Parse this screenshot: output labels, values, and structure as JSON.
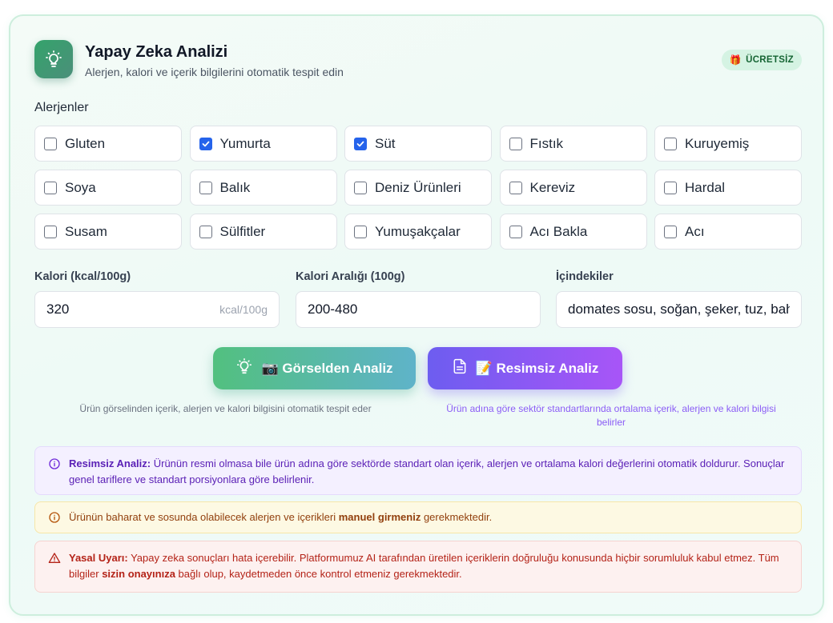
{
  "header": {
    "title": "Yapay Zeka Analizi",
    "subtitle": "Alerjen, kalori ve içerik bilgilerini otomatik tespit edin",
    "badge_icon": "🎁",
    "badge_label": "ÜCRETSİZ"
  },
  "allergens_label": "Alerjenler",
  "allergens": [
    {
      "label": "Gluten",
      "checked": false
    },
    {
      "label": "Yumurta",
      "checked": true
    },
    {
      "label": "Süt",
      "checked": true
    },
    {
      "label": "Fıstık",
      "checked": false
    },
    {
      "label": "Kuruyemiş",
      "checked": false
    },
    {
      "label": "Soya",
      "checked": false
    },
    {
      "label": "Balık",
      "checked": false
    },
    {
      "label": "Deniz Ürünleri",
      "checked": false
    },
    {
      "label": "Kereviz",
      "checked": false
    },
    {
      "label": "Hardal",
      "checked": false
    },
    {
      "label": "Susam",
      "checked": false
    },
    {
      "label": "Sülfitler",
      "checked": false
    },
    {
      "label": "Yumuşakçalar",
      "checked": false
    },
    {
      "label": "Acı Bakla",
      "checked": false
    },
    {
      "label": "Acı",
      "checked": false
    }
  ],
  "fields": {
    "calories_label": "Kalori (kcal/100g)",
    "calories_value": "320",
    "calories_unit": "kcal/100g",
    "range_label": "Kalori Aralığı (100g)",
    "range_value": "200-480",
    "ingredients_label": "İçindekiler",
    "ingredients_value": "domates sosu, soğan, şeker, tuz, baharatlar"
  },
  "buttons": {
    "image_analysis": "📷 Görselden Analiz",
    "image_analysis_desc": "Ürün görselinden içerik, alerjen ve kalori bilgisini otomatik tespit eder",
    "no_image_analysis": "📝 Resimsiz Analiz",
    "no_image_analysis_desc": "Ürün adına göre sektör standartlarında ortalama içerik, alerjen ve kalori bilgisi belirler"
  },
  "notices": {
    "info_bold": "Resimsiz Analiz:",
    "info_text": " Ürünün resmi olmasa bile ürün adına göre sektörde standart olan içerik, alerjen ve ortalama kalori değerlerini otomatik doldurur. Sonuçlar genel tariflere ve standart porsiyonlara göre belirlenir.",
    "warn_text_1": "Ürünün baharat ve sosunda olabilecek alerjen ve içerikleri ",
    "warn_bold": "manuel girmeniz",
    "warn_text_2": " gerekmektedir.",
    "legal_bold": "Yasal Uyarı:",
    "legal_text_1": " Yapay zeka sonuçları hata içerebilir. Platformumuz AI tarafından üretilen içeriklerin doğruluğu konusunda hiçbir sorumluluk kabul etmez. Tüm bilgiler ",
    "legal_bold_2": "sizin onayınıza",
    "legal_text_2": " bağlı olup, kaydetmeden önce kontrol etmeniz gerekmektedir."
  },
  "colors": {
    "accent_green": "#52c07f",
    "accent_purple": "#7c5cf0",
    "checkbox_checked": "#2563eb"
  },
  "icons": {
    "logo": "lightbulb-icon",
    "image_button": "lightbulb-icon",
    "no_image_button": "document-icon",
    "info": "info-circle-icon",
    "warn": "info-circle-icon",
    "legal": "warning-triangle-icon"
  }
}
